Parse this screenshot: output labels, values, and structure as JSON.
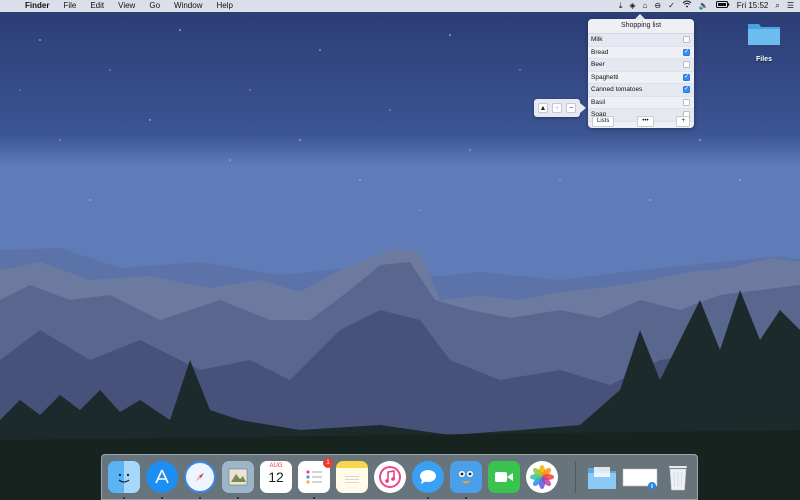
{
  "menubar": {
    "apple": "",
    "items": [
      "Finder",
      "File",
      "Edit",
      "View",
      "Go",
      "Window",
      "Help"
    ],
    "clock": "Fri 15:52",
    "status_icons": [
      "download-icon",
      "dropbox-icon",
      "house-icon",
      "minus-circle-icon",
      "checkmark-icon",
      "wifi-icon",
      "volume-icon",
      "battery-icon",
      "search-icon",
      "list-icon"
    ]
  },
  "shopping_list": {
    "title": "Shopping list",
    "items": [
      {
        "label": "Milk",
        "checked": false
      },
      {
        "label": "Bread",
        "checked": true
      },
      {
        "label": "Beer",
        "checked": false
      },
      {
        "label": "Spaghetti",
        "checked": true
      },
      {
        "label": "Canned tomatoes",
        "checked": true
      },
      {
        "label": "Basil",
        "checked": false
      },
      {
        "label": "Soap",
        "checked": false
      }
    ],
    "lists_button": "Lists",
    "more_button": "•••",
    "add_button": "+"
  },
  "control_panel": {
    "up": "▲",
    "mid": "+",
    "minus": "−"
  },
  "desktop": {
    "folder_label": "Files"
  },
  "dock": {
    "calendar_month": "AUG",
    "calendar_day": "12",
    "reminders_badge": "1",
    "items": [
      "finder-icon",
      "app-store-icon",
      "safari-icon",
      "preview-icon",
      "calendar-icon",
      "reminders-icon",
      "notes-icon",
      "itunes-icon",
      "messages-icon",
      "tweetbot-icon",
      "facetime-icon",
      "photos-icon",
      "downloads-folder-icon",
      "window-thumbnail-icon",
      "trash-icon"
    ]
  }
}
